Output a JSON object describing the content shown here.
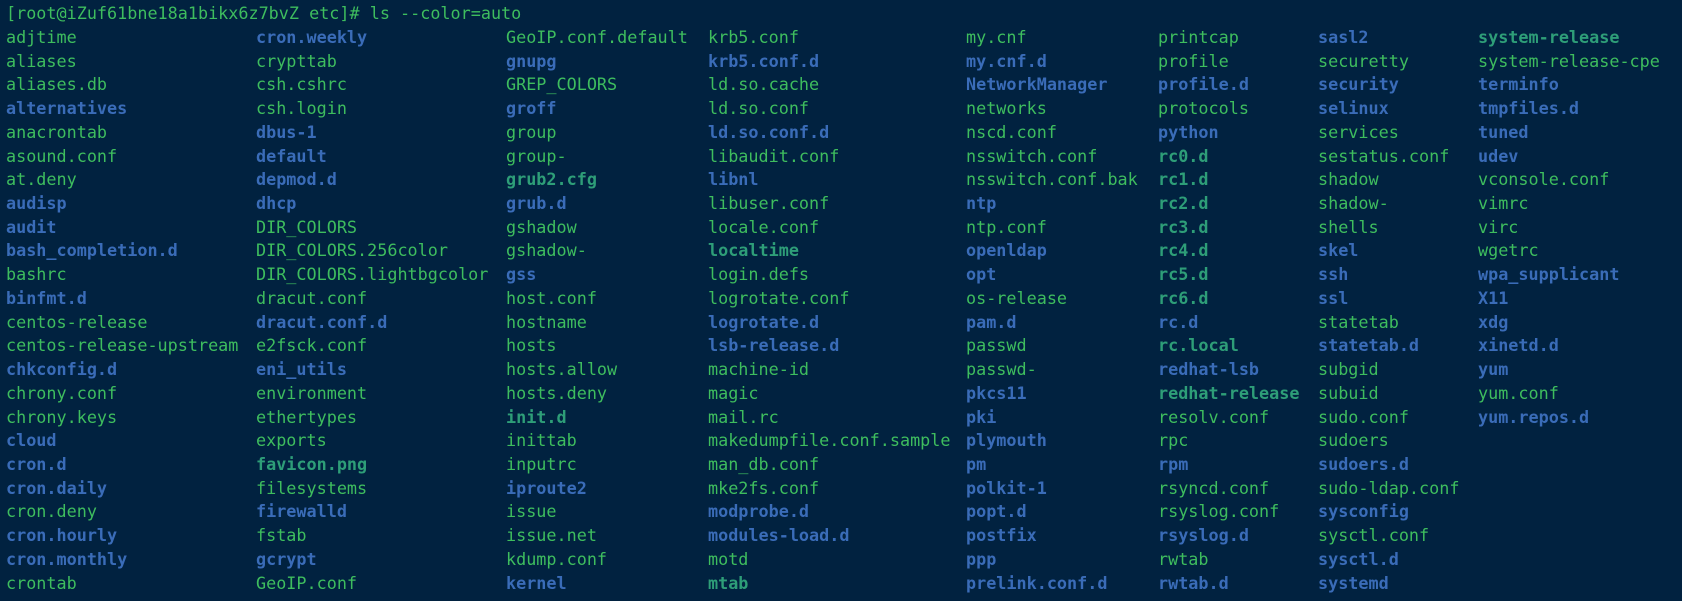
{
  "terminal": {
    "prompt": "[root@iZuf61bne18a1bikx6z7bvZ etc]# ls --color=auto",
    "colors": {
      "background": "#012240",
      "file": "#3ebd5e",
      "dir": "#3a6cb8",
      "link": "#2e9e78"
    },
    "columns": [
      [
        {
          "name": "adjtime",
          "type": "file"
        },
        {
          "name": "aliases",
          "type": "file"
        },
        {
          "name": "aliases.db",
          "type": "file"
        },
        {
          "name": "alternatives",
          "type": "dir"
        },
        {
          "name": "anacrontab",
          "type": "file"
        },
        {
          "name": "asound.conf",
          "type": "file"
        },
        {
          "name": "at.deny",
          "type": "file"
        },
        {
          "name": "audisp",
          "type": "dir"
        },
        {
          "name": "audit",
          "type": "dir"
        },
        {
          "name": "bash_completion.d",
          "type": "dir"
        },
        {
          "name": "bashrc",
          "type": "file"
        },
        {
          "name": "binfmt.d",
          "type": "dir"
        },
        {
          "name": "centos-release",
          "type": "file"
        },
        {
          "name": "centos-release-upstream",
          "type": "file"
        },
        {
          "name": "chkconfig.d",
          "type": "dir"
        },
        {
          "name": "chrony.conf",
          "type": "file"
        },
        {
          "name": "chrony.keys",
          "type": "file"
        },
        {
          "name": "cloud",
          "type": "dir"
        },
        {
          "name": "cron.d",
          "type": "dir"
        },
        {
          "name": "cron.daily",
          "type": "dir"
        },
        {
          "name": "cron.deny",
          "type": "file"
        },
        {
          "name": "cron.hourly",
          "type": "dir"
        },
        {
          "name": "cron.monthly",
          "type": "dir"
        },
        {
          "name": "crontab",
          "type": "file"
        }
      ],
      [
        {
          "name": "cron.weekly",
          "type": "dir"
        },
        {
          "name": "crypttab",
          "type": "file"
        },
        {
          "name": "csh.cshrc",
          "type": "file"
        },
        {
          "name": "csh.login",
          "type": "file"
        },
        {
          "name": "dbus-1",
          "type": "dir"
        },
        {
          "name": "default",
          "type": "dir"
        },
        {
          "name": "depmod.d",
          "type": "dir"
        },
        {
          "name": "dhcp",
          "type": "dir"
        },
        {
          "name": "DIR_COLORS",
          "type": "file"
        },
        {
          "name": "DIR_COLORS.256color",
          "type": "file"
        },
        {
          "name": "DIR_COLORS.lightbgcolor",
          "type": "file"
        },
        {
          "name": "dracut.conf",
          "type": "file"
        },
        {
          "name": "dracut.conf.d",
          "type": "dir"
        },
        {
          "name": "e2fsck.conf",
          "type": "file"
        },
        {
          "name": "eni_utils",
          "type": "dir"
        },
        {
          "name": "environment",
          "type": "file"
        },
        {
          "name": "ethertypes",
          "type": "file"
        },
        {
          "name": "exports",
          "type": "file"
        },
        {
          "name": "favicon.png",
          "type": "link"
        },
        {
          "name": "filesystems",
          "type": "file"
        },
        {
          "name": "firewalld",
          "type": "dir"
        },
        {
          "name": "fstab",
          "type": "file"
        },
        {
          "name": "gcrypt",
          "type": "dir"
        },
        {
          "name": "GeoIP.conf",
          "type": "file"
        }
      ],
      [
        {
          "name": "GeoIP.conf.default",
          "type": "file"
        },
        {
          "name": "gnupg",
          "type": "dir"
        },
        {
          "name": "GREP_COLORS",
          "type": "file"
        },
        {
          "name": "groff",
          "type": "dir"
        },
        {
          "name": "group",
          "type": "file"
        },
        {
          "name": "group-",
          "type": "file"
        },
        {
          "name": "grub2.cfg",
          "type": "link"
        },
        {
          "name": "grub.d",
          "type": "dir"
        },
        {
          "name": "gshadow",
          "type": "file"
        },
        {
          "name": "gshadow-",
          "type": "file"
        },
        {
          "name": "gss",
          "type": "dir"
        },
        {
          "name": "host.conf",
          "type": "file"
        },
        {
          "name": "hostname",
          "type": "file"
        },
        {
          "name": "hosts",
          "type": "file"
        },
        {
          "name": "hosts.allow",
          "type": "file"
        },
        {
          "name": "hosts.deny",
          "type": "file"
        },
        {
          "name": "init.d",
          "type": "link"
        },
        {
          "name": "inittab",
          "type": "file"
        },
        {
          "name": "inputrc",
          "type": "file"
        },
        {
          "name": "iproute2",
          "type": "dir"
        },
        {
          "name": "issue",
          "type": "file"
        },
        {
          "name": "issue.net",
          "type": "file"
        },
        {
          "name": "kdump.conf",
          "type": "file"
        },
        {
          "name": "kernel",
          "type": "dir"
        }
      ],
      [
        {
          "name": "krb5.conf",
          "type": "file"
        },
        {
          "name": "krb5.conf.d",
          "type": "dir"
        },
        {
          "name": "ld.so.cache",
          "type": "file"
        },
        {
          "name": "ld.so.conf",
          "type": "file"
        },
        {
          "name": "ld.so.conf.d",
          "type": "dir"
        },
        {
          "name": "libaudit.conf",
          "type": "file"
        },
        {
          "name": "libnl",
          "type": "dir"
        },
        {
          "name": "libuser.conf",
          "type": "file"
        },
        {
          "name": "locale.conf",
          "type": "file"
        },
        {
          "name": "localtime",
          "type": "link"
        },
        {
          "name": "login.defs",
          "type": "file"
        },
        {
          "name": "logrotate.conf",
          "type": "file"
        },
        {
          "name": "logrotate.d",
          "type": "dir"
        },
        {
          "name": "lsb-release.d",
          "type": "dir"
        },
        {
          "name": "machine-id",
          "type": "file"
        },
        {
          "name": "magic",
          "type": "file"
        },
        {
          "name": "mail.rc",
          "type": "file"
        },
        {
          "name": "makedumpfile.conf.sample",
          "type": "file"
        },
        {
          "name": "man_db.conf",
          "type": "file"
        },
        {
          "name": "mke2fs.conf",
          "type": "file"
        },
        {
          "name": "modprobe.d",
          "type": "dir"
        },
        {
          "name": "modules-load.d",
          "type": "dir"
        },
        {
          "name": "motd",
          "type": "file"
        },
        {
          "name": "mtab",
          "type": "link"
        }
      ],
      [
        {
          "name": "my.cnf",
          "type": "file"
        },
        {
          "name": "my.cnf.d",
          "type": "dir"
        },
        {
          "name": "NetworkManager",
          "type": "dir"
        },
        {
          "name": "networks",
          "type": "file"
        },
        {
          "name": "nscd.conf",
          "type": "file"
        },
        {
          "name": "nsswitch.conf",
          "type": "file"
        },
        {
          "name": "nsswitch.conf.bak",
          "type": "file"
        },
        {
          "name": "ntp",
          "type": "dir"
        },
        {
          "name": "ntp.conf",
          "type": "file"
        },
        {
          "name": "openldap",
          "type": "dir"
        },
        {
          "name": "opt",
          "type": "dir"
        },
        {
          "name": "os-release",
          "type": "file"
        },
        {
          "name": "pam.d",
          "type": "dir"
        },
        {
          "name": "passwd",
          "type": "file"
        },
        {
          "name": "passwd-",
          "type": "file"
        },
        {
          "name": "pkcs11",
          "type": "dir"
        },
        {
          "name": "pki",
          "type": "dir"
        },
        {
          "name": "plymouth",
          "type": "dir"
        },
        {
          "name": "pm",
          "type": "dir"
        },
        {
          "name": "polkit-1",
          "type": "dir"
        },
        {
          "name": "popt.d",
          "type": "dir"
        },
        {
          "name": "postfix",
          "type": "dir"
        },
        {
          "name": "ppp",
          "type": "dir"
        },
        {
          "name": "prelink.conf.d",
          "type": "dir"
        }
      ],
      [
        {
          "name": "printcap",
          "type": "file"
        },
        {
          "name": "profile",
          "type": "file"
        },
        {
          "name": "profile.d",
          "type": "dir"
        },
        {
          "name": "protocols",
          "type": "file"
        },
        {
          "name": "python",
          "type": "dir"
        },
        {
          "name": "rc0.d",
          "type": "link"
        },
        {
          "name": "rc1.d",
          "type": "link"
        },
        {
          "name": "rc2.d",
          "type": "link"
        },
        {
          "name": "rc3.d",
          "type": "link"
        },
        {
          "name": "rc4.d",
          "type": "link"
        },
        {
          "name": "rc5.d",
          "type": "link"
        },
        {
          "name": "rc6.d",
          "type": "link"
        },
        {
          "name": "rc.d",
          "type": "dir"
        },
        {
          "name": "rc.local",
          "type": "link"
        },
        {
          "name": "redhat-lsb",
          "type": "dir"
        },
        {
          "name": "redhat-release",
          "type": "link"
        },
        {
          "name": "resolv.conf",
          "type": "file"
        },
        {
          "name": "rpc",
          "type": "file"
        },
        {
          "name": "rpm",
          "type": "dir"
        },
        {
          "name": "rsyncd.conf",
          "type": "file"
        },
        {
          "name": "rsyslog.conf",
          "type": "file"
        },
        {
          "name": "rsyslog.d",
          "type": "dir"
        },
        {
          "name": "rwtab",
          "type": "file"
        },
        {
          "name": "rwtab.d",
          "type": "dir"
        }
      ],
      [
        {
          "name": "sasl2",
          "type": "dir"
        },
        {
          "name": "securetty",
          "type": "file"
        },
        {
          "name": "security",
          "type": "dir"
        },
        {
          "name": "selinux",
          "type": "dir"
        },
        {
          "name": "services",
          "type": "file"
        },
        {
          "name": "sestatus.conf",
          "type": "file"
        },
        {
          "name": "shadow",
          "type": "file"
        },
        {
          "name": "shadow-",
          "type": "file"
        },
        {
          "name": "shells",
          "type": "file"
        },
        {
          "name": "skel",
          "type": "dir"
        },
        {
          "name": "ssh",
          "type": "dir"
        },
        {
          "name": "ssl",
          "type": "dir"
        },
        {
          "name": "statetab",
          "type": "file"
        },
        {
          "name": "statetab.d",
          "type": "dir"
        },
        {
          "name": "subgid",
          "type": "file"
        },
        {
          "name": "subuid",
          "type": "file"
        },
        {
          "name": "sudo.conf",
          "type": "file"
        },
        {
          "name": "sudoers",
          "type": "file"
        },
        {
          "name": "sudoers.d",
          "type": "dir"
        },
        {
          "name": "sudo-ldap.conf",
          "type": "file"
        },
        {
          "name": "sysconfig",
          "type": "dir"
        },
        {
          "name": "sysctl.conf",
          "type": "file"
        },
        {
          "name": "sysctl.d",
          "type": "dir"
        },
        {
          "name": "systemd",
          "type": "dir"
        }
      ],
      [
        {
          "name": "system-release",
          "type": "link"
        },
        {
          "name": "system-release-cpe",
          "type": "file"
        },
        {
          "name": "terminfo",
          "type": "dir"
        },
        {
          "name": "tmpfiles.d",
          "type": "dir"
        },
        {
          "name": "tuned",
          "type": "dir"
        },
        {
          "name": "udev",
          "type": "dir"
        },
        {
          "name": "vconsole.conf",
          "type": "file"
        },
        {
          "name": "vimrc",
          "type": "file"
        },
        {
          "name": "virc",
          "type": "file"
        },
        {
          "name": "wgetrc",
          "type": "file"
        },
        {
          "name": "wpa_supplicant",
          "type": "dir"
        },
        {
          "name": "X11",
          "type": "dir"
        },
        {
          "name": "xdg",
          "type": "dir"
        },
        {
          "name": "xinetd.d",
          "type": "dir"
        },
        {
          "name": "yum",
          "type": "dir"
        },
        {
          "name": "yum.conf",
          "type": "file"
        },
        {
          "name": "yum.repos.d",
          "type": "dir"
        }
      ]
    ]
  }
}
